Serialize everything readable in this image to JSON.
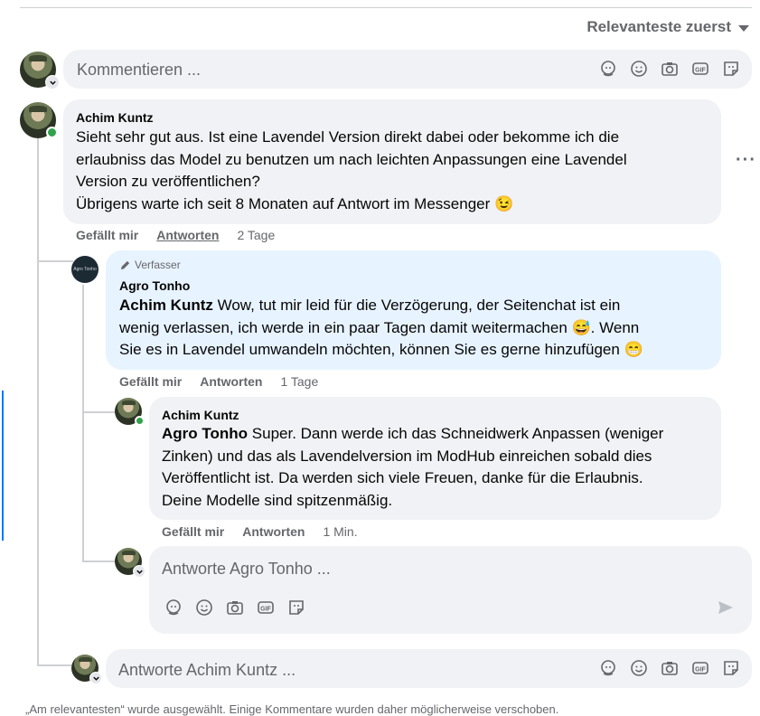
{
  "sort": {
    "label": "Relevanteste zuerst"
  },
  "comment_input": {
    "placeholder": "Kommentieren ..."
  },
  "comments": [
    {
      "author": "Achim Kuntz",
      "lines": [
        "Sieht sehr gut aus. Ist eine Lavendel Version direkt dabei oder bekomme ich die",
        "erlaubniss das Model zu benutzen um nach leichten Anpassungen eine Lavendel",
        "Version zu veröffentlichen?",
        "Übrigens warte ich seit 8 Monaten auf Antwort im Messenger 😉"
      ],
      "like": "Gefällt mir",
      "reply": "Antworten",
      "time": "2 Tage",
      "more": "···"
    },
    {
      "badge": "Verfasser",
      "author": "Agro Tonho",
      "avatar_text": "Agro Tonho",
      "mention": "Achim Kuntz",
      "lines": [
        " Wow, tut mir leid für die Verzögerung, der Seitenchat ist ein",
        "wenig verlassen, ich werde in ein paar Tagen damit weitermachen 😅. Wenn",
        "Sie es in Lavendel umwandeln möchten, können Sie es gerne hinzufügen 😁"
      ],
      "like": "Gefällt mir",
      "reply": "Antworten",
      "time": "1 Tage"
    },
    {
      "author": "Achim Kuntz",
      "mention": "Agro Tonho",
      "lines": [
        " Super. Dann werde ich das Schneidwerk Anpassen (weniger",
        "Zinken) und das als Lavendelversion im ModHub einreichen sobald dies",
        "Veröffentlicht ist. Da werden sich viele Freuen, danke für die Erlaubnis.",
        "Deine Modelle sind spitzenmäßig."
      ],
      "like": "Gefällt mir",
      "reply": "Antworten",
      "time": "1 Min."
    }
  ],
  "reply_input_1": {
    "placeholder": "Antworte Agro Tonho ..."
  },
  "reply_input_2": {
    "placeholder": "Antworte Achim Kuntz ..."
  },
  "footer": {
    "text": "„Am relevantesten“ wurde ausgewählt. Einige Kommentare wurden daher möglicherweise verschoben."
  },
  "icons": [
    "avatar-sticker-icon",
    "emoji-icon",
    "camera-icon",
    "gif-icon",
    "sticker-icon",
    "send-icon",
    "pencil-icon",
    "more-icon",
    "chevron-down-icon"
  ],
  "colors": {
    "accent": "#1877f2",
    "online": "#31a24c",
    "bubble": "#f0f2f5",
    "author_bubble": "#e7f3ff",
    "muted": "#65676b"
  }
}
